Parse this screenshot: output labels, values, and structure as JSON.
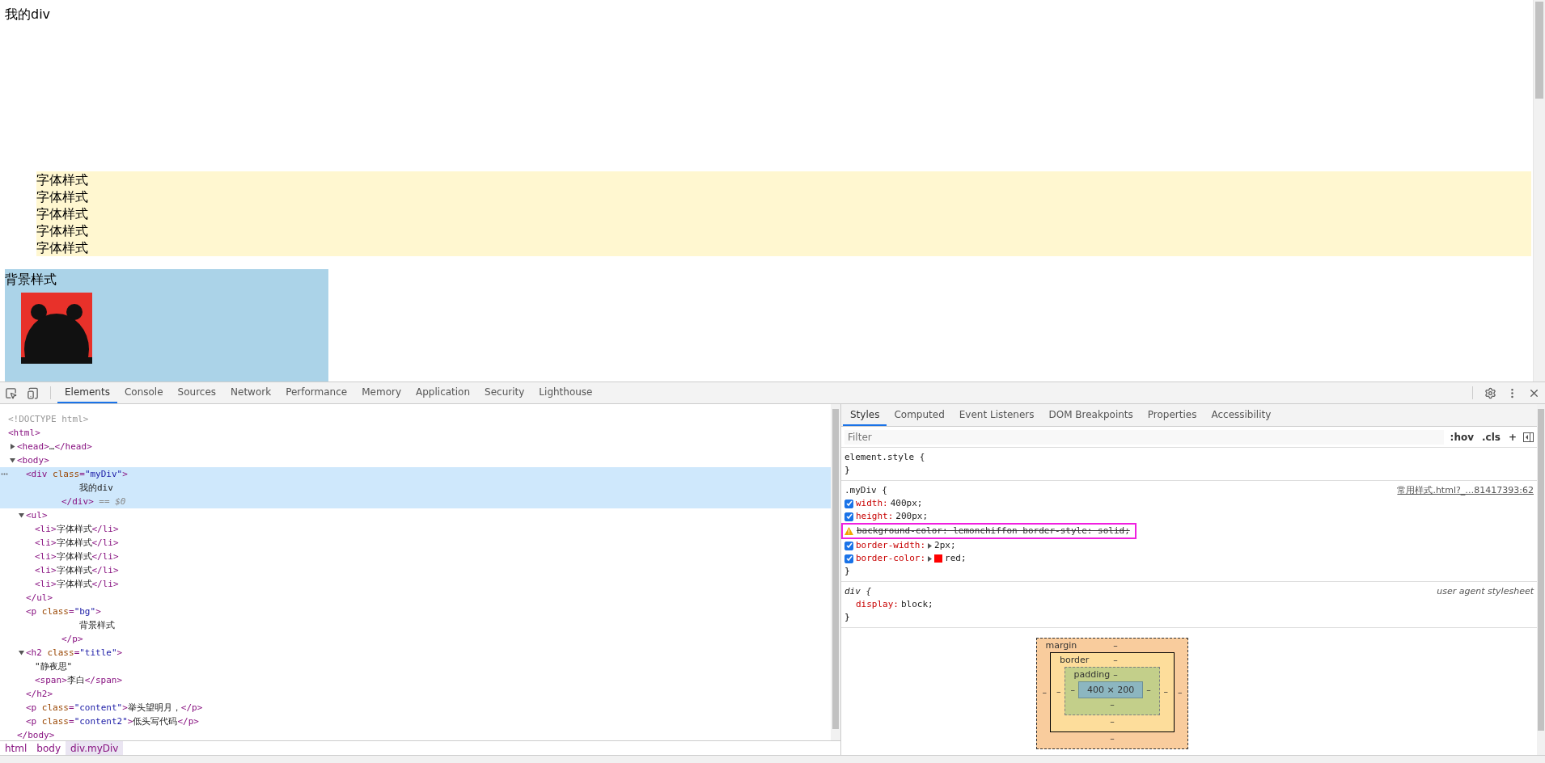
{
  "page": {
    "heading": "我的div",
    "list_items": [
      "字体样式",
      "字体样式",
      "字体样式",
      "字体样式",
      "字体样式"
    ],
    "bg_paragraph": {
      "text": "背景样式"
    }
  },
  "devtools": {
    "tabs": [
      {
        "label": "Elements",
        "selected": true
      },
      {
        "label": "Console",
        "selected": false
      },
      {
        "label": "Sources",
        "selected": false
      },
      {
        "label": "Network",
        "selected": false
      },
      {
        "label": "Performance",
        "selected": false
      },
      {
        "label": "Memory",
        "selected": false
      },
      {
        "label": "Application",
        "selected": false
      },
      {
        "label": "Security",
        "selected": false
      },
      {
        "label": "Lighthouse",
        "selected": false
      }
    ],
    "elements": {
      "dom_tree": [
        {
          "open": "<!DOCTYPE html>",
          "kind": "doctype"
        },
        {
          "open": "<html>",
          "children": [
            {
              "open": "<head>…</head>",
              "expanded": false
            },
            {
              "open": "<body>",
              "expanded": true,
              "close": "</body>",
              "children": [
                {
                  "open": "<div class=\"myDiv\">",
                  "selected": true,
                  "children": [
                    {
                      "text": "我的div"
                    }
                  ],
                  "close": "</div>",
                  "marker": "== $0"
                },
                {
                  "open": "<ul>",
                  "expanded": true,
                  "close": "</ul>",
                  "children": [
                    {
                      "open": "<li>",
                      "text": "字体样式",
                      "close": "</li>"
                    },
                    {
                      "open": "<li>",
                      "text": "字体样式",
                      "close": "</li>"
                    },
                    {
                      "open": "<li>",
                      "text": "字体样式",
                      "close": "</li>"
                    },
                    {
                      "open": "<li>",
                      "text": "字体样式",
                      "close": "</li>"
                    },
                    {
                      "open": "<li>",
                      "text": "字体样式",
                      "close": "</li>"
                    }
                  ]
                },
                {
                  "open": "<p class=\"bg\">",
                  "children": [
                    {
                      "text": "背景样式"
                    }
                  ],
                  "close": "</p>"
                },
                {
                  "open": "<h2 class=\"title\">",
                  "expanded": true,
                  "close": "</h2>",
                  "children": [
                    {
                      "text": "\"静夜思\""
                    },
                    {
                      "open": "<span>",
                      "text": "李白",
                      "close": "</span>"
                    }
                  ]
                },
                {
                  "open": "<p class=\"content\">",
                  "text": "举头望明月，",
                  "close": "</p>"
                },
                {
                  "open": "<p class=\"content2\">",
                  "text": "低头写代码",
                  "close": "</p>"
                }
              ]
            }
          ]
        }
      ],
      "breadcrumbs": [
        {
          "label": "html",
          "selected": false
        },
        {
          "label": "body",
          "selected": false
        },
        {
          "label": "div.myDiv",
          "selected": true
        }
      ]
    },
    "sidebar_tabs": [
      {
        "label": "Styles",
        "selected": true
      },
      {
        "label": "Computed",
        "selected": false
      },
      {
        "label": "Event Listeners",
        "selected": false
      },
      {
        "label": "DOM Breakpoints",
        "selected": false
      },
      {
        "label": "Properties",
        "selected": false
      },
      {
        "label": "Accessibility",
        "selected": false
      }
    ],
    "filter": {
      "placeholder": "Filter"
    },
    "filter_buttons": [
      ":hov",
      ".cls",
      "+"
    ],
    "rules": [
      {
        "selector": "element.style {",
        "close": "}"
      },
      {
        "selector": ".myDiv {",
        "source": "常用样式.html?_…81417393:62",
        "close": "}",
        "declarations": [
          {
            "kind": "checkbox",
            "checked": true,
            "name": "width:",
            "value": "400px;"
          },
          {
            "kind": "checkbox",
            "checked": true,
            "name": "height:",
            "value": "200px;"
          },
          {
            "kind": "invalid",
            "text": "background-color: lemonchiffon border-style: solid;",
            "highlighted": true
          },
          {
            "kind": "checkbox",
            "checked": true,
            "name": "border-width:",
            "value": "2px;",
            "expandable": true
          },
          {
            "kind": "checkbox",
            "checked": true,
            "name": "border-color:",
            "value": "red;",
            "expandable": true,
            "color": "#ff0000"
          }
        ]
      },
      {
        "selector": "div {",
        "source": "user agent stylesheet",
        "italic": true,
        "close": "}",
        "declarations": [
          {
            "kind": "plain",
            "name": "display:",
            "value": "block;"
          }
        ]
      }
    ],
    "box_model": {
      "kind": "margin",
      "label": "margin",
      "top": "–",
      "left": "–",
      "inner": {
        "kind": "border",
        "label": "border",
        "top": "–",
        "left": "–",
        "inner": {
          "kind": "padding",
          "label": "padding",
          "top": "–",
          "left": "–",
          "inner": {
            "kind": "content",
            "text": "400 × 200"
          },
          "right": "–",
          "bottom": "–"
        },
        "right": "–",
        "bottom": "–"
      },
      "right": "–",
      "bottom": "–"
    }
  }
}
